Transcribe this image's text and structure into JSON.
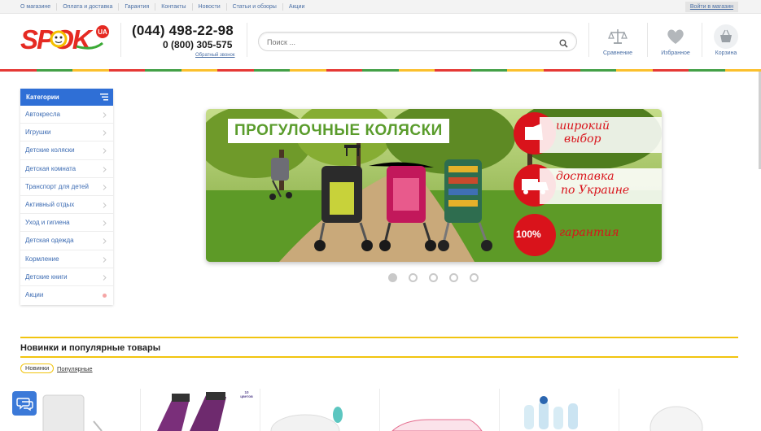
{
  "topnav": {
    "links": [
      "О магазине",
      "Оплата и доставка",
      "Гарантия",
      "Контакты",
      "Новости",
      "Статьи и обзоры",
      "Акции"
    ],
    "login": "Войти в магазин"
  },
  "header": {
    "logo_text": "SPOK",
    "logo_badge": "UA",
    "phone_main": "(044) 498-22-98",
    "phone_free": "0 (800) 305-575",
    "callback": "Обратный звонок",
    "search_placeholder": "Поиск ...",
    "icons": [
      {
        "name": "scales-icon",
        "label": "Сравнение"
      },
      {
        "name": "heart-icon",
        "label": "Избранное"
      },
      {
        "name": "basket-icon",
        "label": "Корзина"
      }
    ]
  },
  "stripe_colors": [
    "#e53935",
    "#43a047",
    "#fbc02d",
    "#e53935",
    "#43a047",
    "#fbc02d",
    "#e53935",
    "#43a047",
    "#fbc02d",
    "#e53935",
    "#43a047",
    "#fbc02d",
    "#e53935",
    "#43a047",
    "#fbc02d",
    "#e53935",
    "#43a047",
    "#fbc02d",
    "#e53935",
    "#43a047",
    "#fbc02d"
  ],
  "sidebar": {
    "title": "Категории",
    "items": [
      {
        "label": "Автокресла"
      },
      {
        "label": "Игрушки"
      },
      {
        "label": "Детские коляски"
      },
      {
        "label": "Детская комната"
      },
      {
        "label": "Транспорт для детей"
      },
      {
        "label": "Активный отдых"
      },
      {
        "label": "Уход и гигиена"
      },
      {
        "label": "Детская одежда"
      },
      {
        "label": "Кормление"
      },
      {
        "label": "Детские книги"
      },
      {
        "label": "Акции"
      }
    ]
  },
  "banner": {
    "title": "ПРОГУЛОЧНЫЕ КОЛЯСКИ",
    "feature_1a": "широкий",
    "feature_1b": "выбор",
    "feature_2a": "доставка",
    "feature_2b": "по Украине",
    "feature_3": "гарантия",
    "feature_3_badge": "100%",
    "slides_total": 5,
    "slide_active": 1
  },
  "section": {
    "title": "Новинки и популярные товары",
    "tab_new": "Новинки",
    "tab_popular": "Популярные",
    "badge_number": "10",
    "badge_text": "цветов"
  },
  "colors": {
    "accent_blue": "#2f6fd6",
    "link_blue": "#4a6fa5",
    "gold": "#f1c40f",
    "banner_red": "#d9131b",
    "banner_green": "#5a9c2c"
  }
}
